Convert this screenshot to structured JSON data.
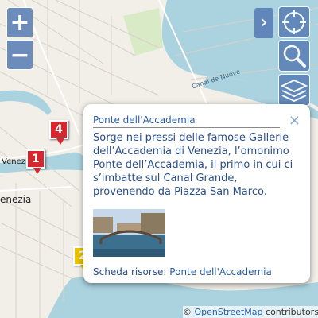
{
  "controls": {
    "zoom_in": "+",
    "zoom_out": "−",
    "expand": "›"
  },
  "map": {
    "labels": [
      {
        "text": "Venezia Sa"
      },
      {
        "text": "enezia"
      },
      {
        "text": "Canal de Nuove"
      }
    ],
    "markers": [
      {
        "number": "4",
        "color": "#d7262e"
      },
      {
        "number": "1",
        "color": "#d7262e"
      },
      {
        "number": "2",
        "color": "#e9c200"
      }
    ]
  },
  "popup": {
    "title": "Ponte dell'Accademia",
    "close": "×",
    "body": "Sorge nei pressi delle famose Gallerie dell’Accademia di Venezia, l’omonimo Ponte dell’Accademia, il primo in cui ci s’imbatte sul Canal Grande, provenendo da Piazza San Marco.",
    "footer_label": "Scheda risorse:",
    "footer_link": "Ponte dell'Accademia"
  },
  "attribution": {
    "prefix": "©",
    "link": "OpenStreetMap",
    "suffix": "contributors"
  },
  "icons": [
    "locate-icon",
    "search-icon",
    "layers-icon"
  ]
}
